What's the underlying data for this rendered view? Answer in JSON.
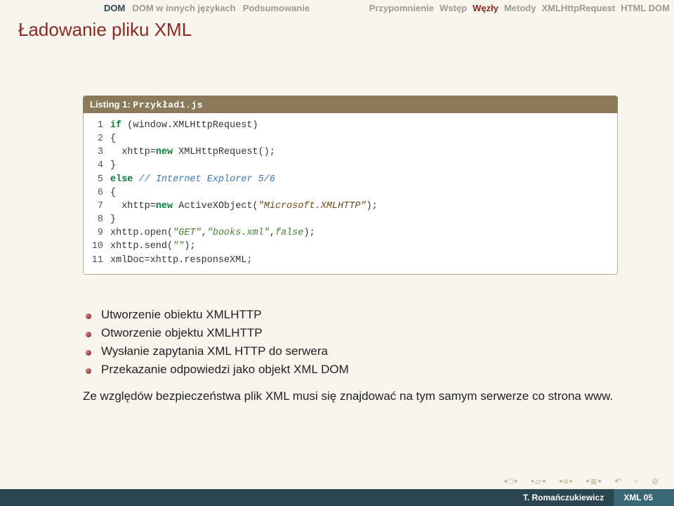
{
  "nav": {
    "left": [
      "DOM",
      "DOM w innych językach",
      "Podsumowanie"
    ],
    "right": [
      "Przypomnienie",
      "Wstęp",
      "Węzły",
      "Metody",
      "XMLHttpRequest",
      "HTML DOM"
    ],
    "left_active": 0,
    "right_active": 2
  },
  "title": "Ładowanie pliku XML",
  "listing": {
    "label": "Listing 1:",
    "filename": "Przykład1.js",
    "lines": [
      {
        "n": "1",
        "seg": [
          {
            "c": "kw",
            "t": "if"
          },
          {
            "t": " (window.XMLHttpRequest)"
          }
        ]
      },
      {
        "n": "2",
        "seg": [
          {
            "t": "{"
          }
        ]
      },
      {
        "n": "3",
        "seg": [
          {
            "t": "  xhttp="
          },
          {
            "c": "kw",
            "t": "new"
          },
          {
            "t": " XMLHttpRequest();"
          }
        ]
      },
      {
        "n": "4",
        "seg": [
          {
            "t": "}"
          }
        ]
      },
      {
        "n": "5",
        "seg": [
          {
            "c": "kw",
            "t": "else"
          },
          {
            "t": " "
          },
          {
            "c": "cm",
            "t": "// Internet Explorer 5/6"
          }
        ]
      },
      {
        "n": "6",
        "seg": [
          {
            "t": "{"
          }
        ]
      },
      {
        "n": "7",
        "seg": [
          {
            "t": "  xhttp="
          },
          {
            "c": "kw",
            "t": "new"
          },
          {
            "t": " ActiveXObject("
          },
          {
            "c": "hl",
            "t": "\"Microsoft.XMLHTTP\""
          },
          {
            "t": ");"
          }
        ]
      },
      {
        "n": "8",
        "seg": [
          {
            "t": "}"
          }
        ]
      },
      {
        "n": "9",
        "seg": [
          {
            "t": "xhttp.open("
          },
          {
            "c": "str",
            "t": "\"GET\""
          },
          {
            "t": ","
          },
          {
            "c": "str",
            "t": "\"books.xml\""
          },
          {
            "t": ","
          },
          {
            "c": "const",
            "t": "false"
          },
          {
            "t": ");"
          }
        ]
      },
      {
        "n": "10",
        "seg": [
          {
            "t": "xhttp.send("
          },
          {
            "c": "str",
            "t": "\"\""
          },
          {
            "t": ");"
          }
        ]
      },
      {
        "n": "11",
        "seg": [
          {
            "t": "xmlDoc=xhttp.responseXML;"
          }
        ]
      }
    ]
  },
  "bullets": [
    "Utworzenie obiektu XMLHTTP",
    "Otworzenie objektu XMLHTTP",
    "Wysłanie zapytania XML HTTP do serwera",
    "Przekazanie odpowiedzi jako objekt XML DOM"
  ],
  "paragraph": "Ze względów bezpieczeństwa plik XML musi się znajdować na tym samym serwerze co strona www.",
  "footer": {
    "author": "T. Romańczukiewicz",
    "doc": "XML 05"
  }
}
